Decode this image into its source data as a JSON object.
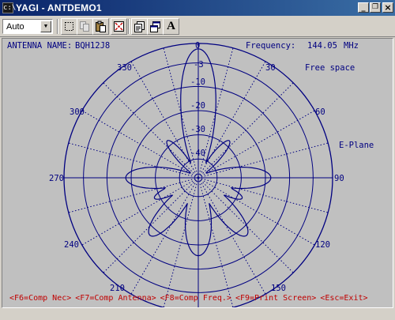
{
  "window": {
    "title": "YAGI - ANTDEMO1",
    "minimize_symbol": "_",
    "restore_symbol": "❐",
    "close_symbol": "×"
  },
  "toolbar": {
    "font_mode_value": "Auto",
    "font_button_label": "A",
    "buttons": [
      "marquee-select-icon",
      "copy-icon",
      "paste-icon",
      "fit-window-icon",
      "properties-icon",
      "full-screen-icon",
      "font-icon"
    ]
  },
  "plot": {
    "antenna_name_label": "ANTENNA NAME:",
    "antenna_name_value": "BQH12J8",
    "frequency_label": "Frequency:",
    "frequency_value": "144.05",
    "frequency_unit": "MHz",
    "environment": "Free space",
    "plane": "E-Plane",
    "background_color": "#c0c0c0",
    "line_color": "#000080",
    "angle_labels": [
      "0",
      "30",
      "60",
      "90",
      "120",
      "150",
      "210",
      "240",
      "270",
      "300",
      "330"
    ],
    "db_labels": [
      "-3",
      "-10",
      "-20",
      "-30",
      "-40"
    ]
  },
  "function_keys": [
    {
      "key": "F6",
      "label": "<F6=Comp Nec>"
    },
    {
      "key": "F7",
      "label": "<F7=Comp Antenna>"
    },
    {
      "key": "F8",
      "label": "<F8=Comp Freq.>"
    },
    {
      "key": "F9",
      "label": "<F9=Print Screen>"
    },
    {
      "key": "Esc",
      "label": "<Esc=Exit>"
    }
  ]
}
